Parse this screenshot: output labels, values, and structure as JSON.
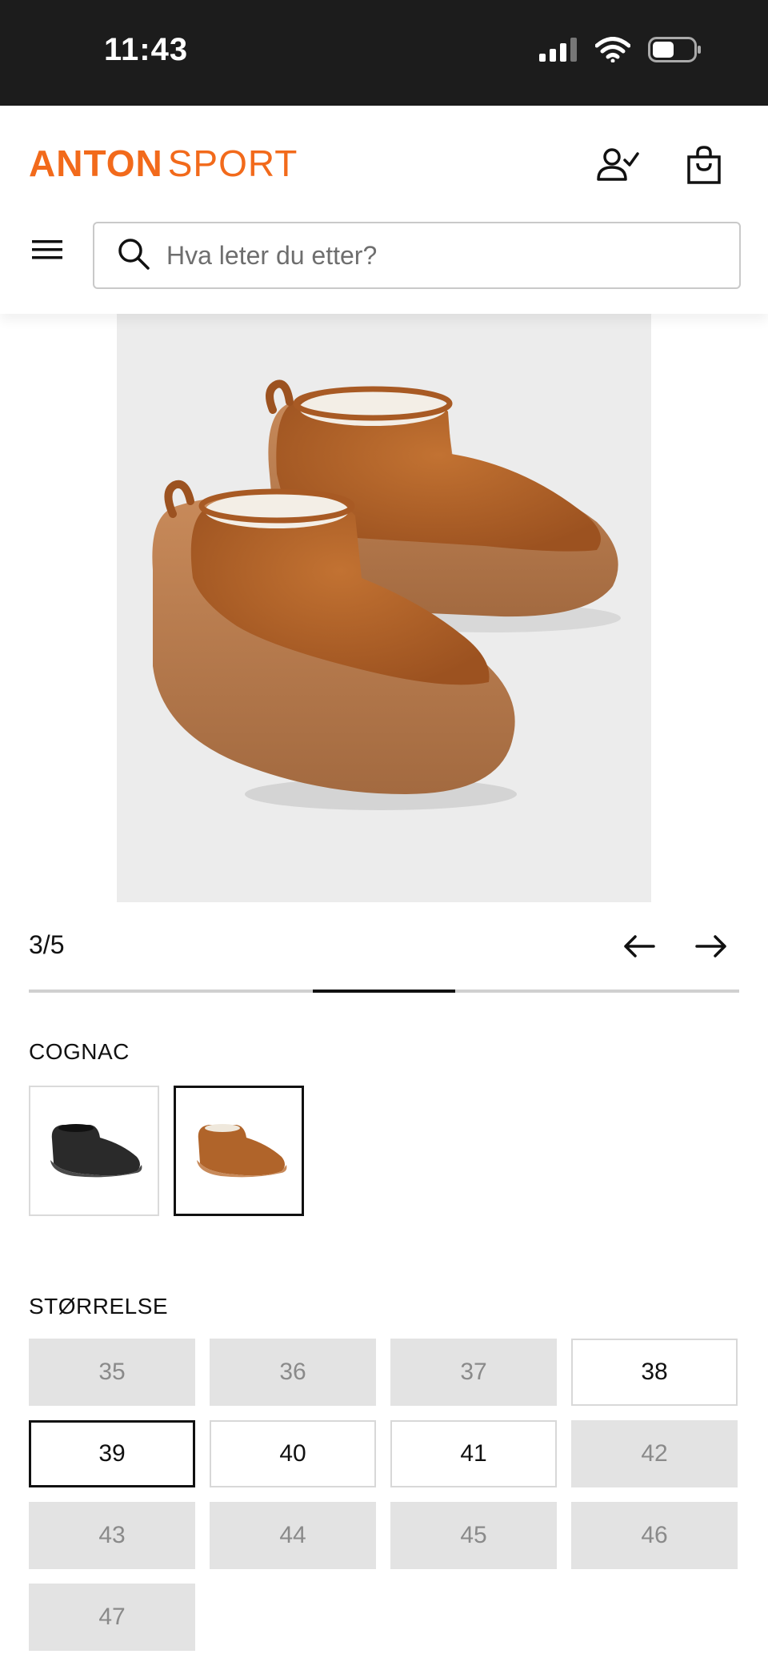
{
  "status_bar": {
    "time": "11:43"
  },
  "header": {
    "logo_bold": "ANTON",
    "logo_light": "SPORT",
    "brand_color": "#f26a1b",
    "search": {
      "placeholder": "Hva leter du etter?",
      "value": ""
    }
  },
  "gallery": {
    "counter": "3/5",
    "current_index": 3,
    "total": 5
  },
  "color": {
    "label": "COGNAC",
    "swatches": [
      {
        "name": "black",
        "selected": false
      },
      {
        "name": "cognac",
        "selected": true
      }
    ]
  },
  "size": {
    "label": "STØRRELSE",
    "options": [
      {
        "label": "35",
        "state": "unavailable"
      },
      {
        "label": "36",
        "state": "unavailable"
      },
      {
        "label": "37",
        "state": "unavailable"
      },
      {
        "label": "38",
        "state": "available"
      },
      {
        "label": "39",
        "state": "selected"
      },
      {
        "label": "40",
        "state": "available"
      },
      {
        "label": "41",
        "state": "available"
      },
      {
        "label": "42",
        "state": "unavailable"
      },
      {
        "label": "43",
        "state": "unavailable"
      },
      {
        "label": "44",
        "state": "unavailable"
      },
      {
        "label": "45",
        "state": "unavailable"
      },
      {
        "label": "46",
        "state": "unavailable"
      },
      {
        "label": "47",
        "state": "unavailable"
      }
    ]
  }
}
